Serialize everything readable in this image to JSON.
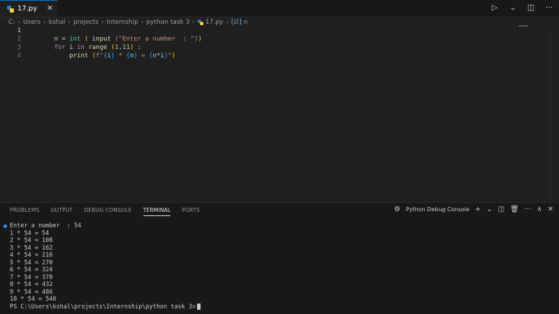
{
  "tab": {
    "filename": "17.py",
    "close": "✕"
  },
  "actions": {
    "run": "▷",
    "run_dropdown": "⌄",
    "split": "◫",
    "more": "···"
  },
  "breadcrumb": {
    "items": [
      "C:",
      "Users",
      "kshal",
      "projects",
      "Internship",
      "python task 3",
      "17.py",
      "n"
    ]
  },
  "editor": {
    "line_numbers": [
      "1",
      "2",
      "3",
      "4"
    ],
    "line1": [
      "n",
      " = ",
      "int",
      " ",
      "(",
      " ",
      "input",
      " ",
      "(",
      "\"Enter a number  : \"",
      ")",
      ")"
    ],
    "line2": [
      "for",
      " ",
      "i",
      " ",
      "in",
      " ",
      "range",
      " ",
      "(",
      "1",
      ",",
      "11",
      ")",
      " :"
    ],
    "line3": [
      "    ",
      "print",
      " ",
      "(",
      "f\"",
      "{",
      "i",
      "}",
      " * ",
      "{",
      "n",
      "}",
      " = ",
      "{",
      "n",
      "*",
      "i",
      "}",
      "\"",
      ")"
    ]
  },
  "panel": {
    "tabs": [
      "PROBLEMS",
      "OUTPUT",
      "DEBUG CONSOLE",
      "TERMINAL",
      "PORTS"
    ],
    "active_tab": "TERMINAL",
    "console_label": "Python Debug Console",
    "add": "+",
    "dropdown": "⌄",
    "split": "◫",
    "trash": "🗑",
    "more": "···",
    "maximize": "∧",
    "close": "✕"
  },
  "terminal": {
    "lines": [
      "Enter a number  : 54",
      "1 * 54 = 54",
      "2 * 54 = 108",
      "3 * 54 = 162",
      "4 * 54 = 216",
      "5 * 54 = 270",
      "6 * 54 = 324",
      "7 * 54 = 378",
      "8 * 54 = 432",
      "9 * 54 = 486",
      "10 * 54 = 540"
    ],
    "prompt": "PS C:\\Users\\kshal\\projects\\Internship\\python task 3>"
  },
  "colors": {
    "accent": "#0078d4",
    "terminal_dot": "#3794ff"
  }
}
